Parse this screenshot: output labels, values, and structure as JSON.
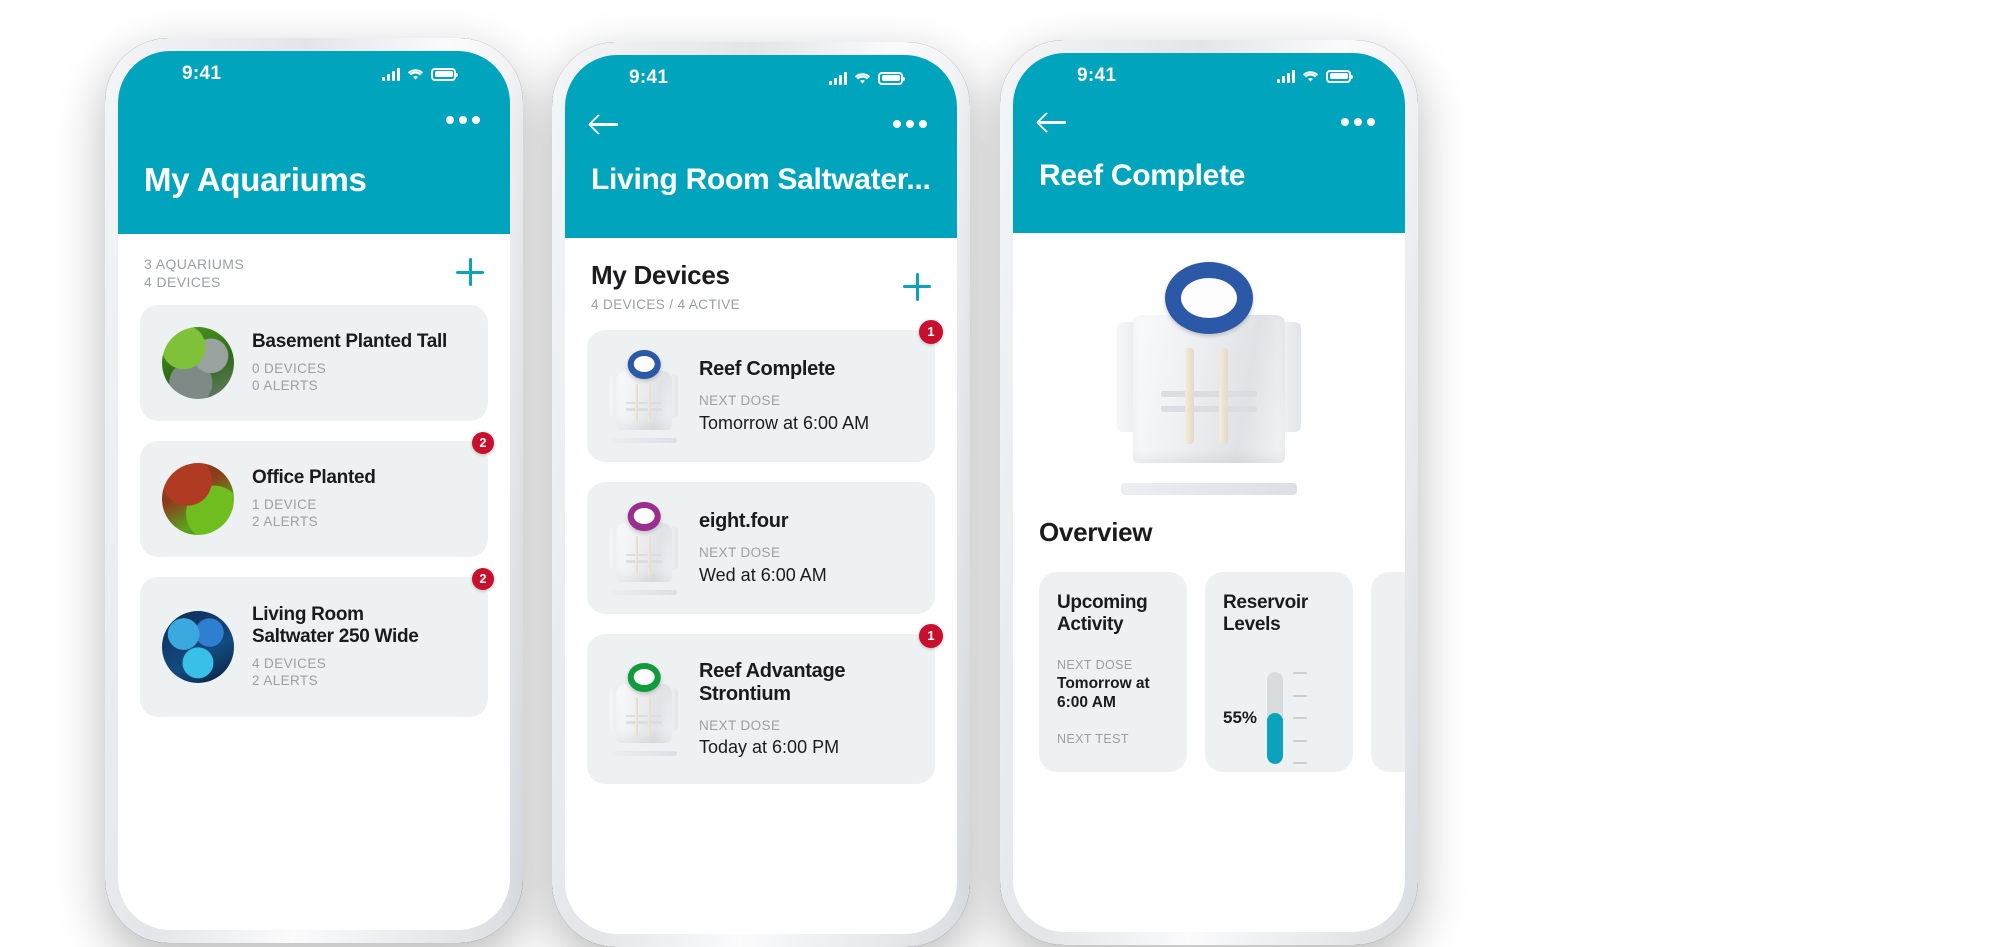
{
  "app": {
    "accent_teal": "#00A5BD",
    "accent_link": "#0AA3BB",
    "badge_red": "#C8102E",
    "card_bg": "#EEF1F2",
    "muted_text": "#9B9EA3"
  },
  "statusbar": {
    "time": "9:41"
  },
  "phone1": {
    "header": {
      "title": "My Aquariums",
      "menu_icon": "kebab-menu-icon"
    },
    "section": {
      "meta_line1": "3 AQUARIUMS",
      "meta_line2": "4 DEVICES",
      "add_icon": "plus-icon"
    },
    "aquariums": [
      {
        "name": "Basement Planted Tall",
        "devices": "0 DEVICES",
        "alerts": "0 ALERTS",
        "badge": "",
        "thumb": "planted-moss-rock-thumbnail"
      },
      {
        "name": "Office Planted",
        "devices": "1 DEVICE",
        "alerts": "2 ALERTS",
        "badge": "2",
        "thumb": "planted-red-green-thumbnail"
      },
      {
        "name": "Living Room Saltwater 250 Wide",
        "devices": "4 DEVICES",
        "alerts": "2 ALERTS",
        "badge": "2",
        "thumb": "blue-coral-thumbnail"
      }
    ]
  },
  "phone2": {
    "header": {
      "title": "Living Room Saltwater...",
      "back_icon": "back-arrow-icon",
      "menu_icon": "kebab-menu-icon"
    },
    "section": {
      "title": "My Devices",
      "meta": "4 DEVICES / 4 ACTIVE",
      "add_icon": "plus-icon"
    },
    "devices": [
      {
        "name": "Reef Complete",
        "label": "NEXT DOSE",
        "value": "Tomorrow at 6:00 AM",
        "badge": "1",
        "cap_color": "#2C58A8"
      },
      {
        "name": "eight.four",
        "label": "NEXT DOSE",
        "value": "Wed at 6:00 AM",
        "badge": "",
        "cap_color": "#9B2D8E"
      },
      {
        "name": "Reef Advantage Strontium",
        "label": "NEXT DOSE",
        "value": "Today at 6:00 PM",
        "badge": "1",
        "cap_color": "#119B3C"
      }
    ]
  },
  "phone3": {
    "header": {
      "title": "Reef Complete",
      "back_icon": "back-arrow-icon",
      "menu_icon": "kebab-menu-icon"
    },
    "hero": {
      "device_image": "doser-device-hero-image",
      "cap_color": "#2C58A8"
    },
    "overview_title": "Overview",
    "cards": [
      {
        "title": "Upcoming Activity",
        "rows": [
          {
            "label": "NEXT DOSE",
            "value": "Tomorrow at 6:00 AM"
          },
          {
            "label": "NEXT TEST",
            "value": ""
          }
        ]
      },
      {
        "title": "Reservoir Levels",
        "percent": "55%",
        "fill": 55
      }
    ]
  }
}
